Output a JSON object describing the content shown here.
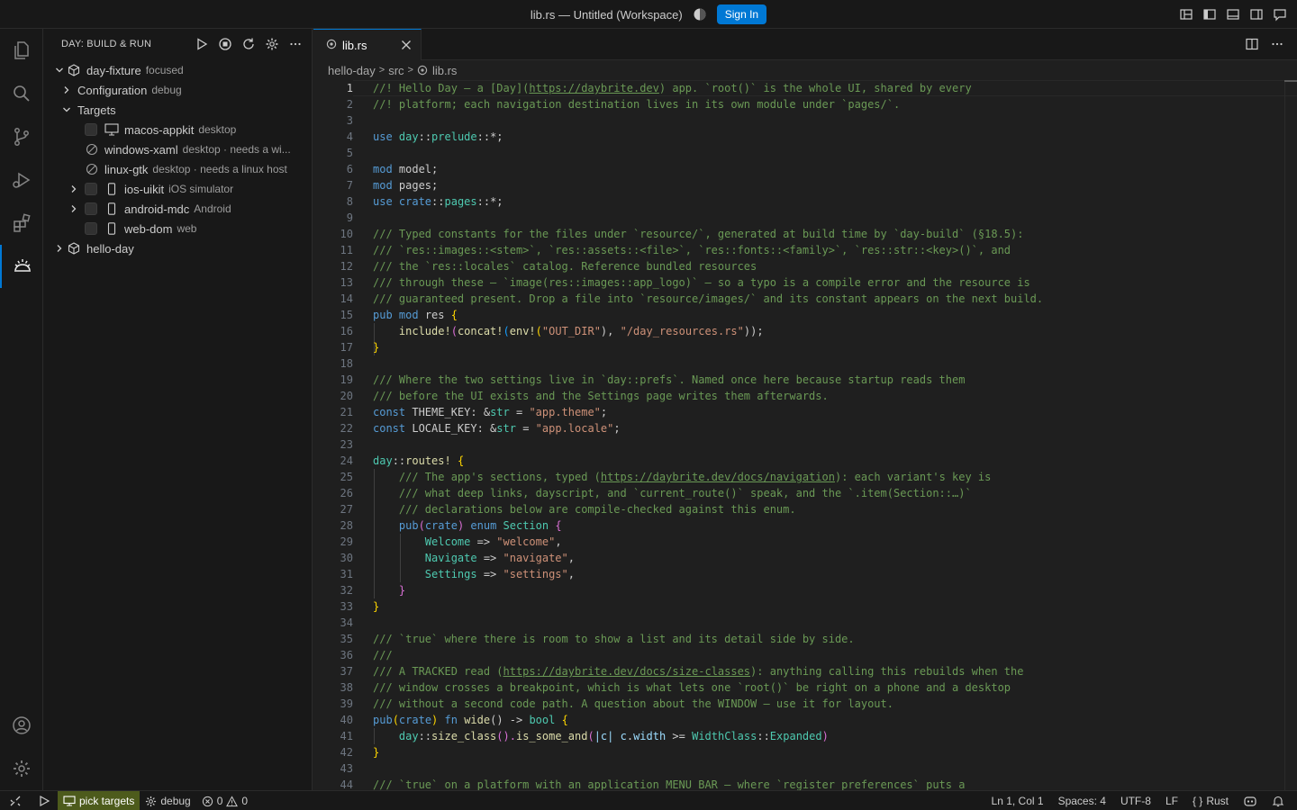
{
  "window": {
    "title": "lib.rs — Untitled (Workspace)",
    "sign_in_label": "Sign In"
  },
  "sidebar": {
    "title": "DAY: BUILD & RUN",
    "tree": [
      {
        "label": "day-fixture",
        "desc": "focused"
      },
      {
        "label": "Configuration",
        "desc": "debug"
      },
      {
        "label": "Targets",
        "desc": ""
      },
      {
        "label": "macos-appkit",
        "desc": "desktop"
      },
      {
        "label": "windows-xaml",
        "desc": "desktop · needs a wi..."
      },
      {
        "label": "linux-gtk",
        "desc": "desktop · needs a linux host"
      },
      {
        "label": "ios-uikit",
        "desc": "iOS simulator"
      },
      {
        "label": "android-mdc",
        "desc": "Android"
      },
      {
        "label": "web-dom",
        "desc": "web"
      },
      {
        "label": "hello-day",
        "desc": ""
      }
    ]
  },
  "editor": {
    "tab_label": "lib.rs",
    "breadcrumb": [
      "hello-day",
      "src",
      "lib.rs"
    ],
    "line_numbers": [
      "1",
      "2",
      "3",
      "4",
      "5",
      "6",
      "7",
      "8",
      "9",
      "10",
      "11",
      "12",
      "13",
      "14",
      "15",
      "16",
      "17",
      "18",
      "19",
      "20",
      "21",
      "22",
      "23",
      "24",
      "25",
      "26",
      "27",
      "28",
      "29",
      "30",
      "31",
      "32",
      "33",
      "34",
      "35",
      "36",
      "37",
      "38",
      "39",
      "40",
      "41",
      "42",
      "43",
      "44"
    ],
    "lines": {
      "l1": [
        "//! Hello Day — a [Day](",
        "https://daybrite.dev",
        ") app. `root()` is the whole UI, shared by every"
      ],
      "l2": "//! platform; each navigation destination lives in its own module under `pages/`.",
      "l4": [
        "use",
        " day",
        "::",
        "prelude",
        "::*;"
      ],
      "l6": [
        "mod",
        " model;"
      ],
      "l7": [
        "mod",
        " pages;"
      ],
      "l8": [
        "use",
        " crate",
        "::",
        "pages",
        "::*;"
      ],
      "l10": "/// Typed constants for the files under `resource/`, generated at build time by `day-build` (§18.5):",
      "l11": "/// `res::images::<stem>`, `res::assets::<file>`, `res::fonts::<family>`, `res::str::<key>()`, and",
      "l12": "/// the `res::locales` catalog. Reference bundled resources",
      "l13": "/// through these — `image(res::images::app_logo)` — so a typo is a compile error and the resource is",
      "l14": "/// guaranteed present. Drop a file into `resource/images/` and its constant appears on the next build.",
      "l15": [
        "pub",
        " mod",
        " res ",
        "{"
      ],
      "l16": [
        "    include!",
        "(",
        "concat!",
        "(",
        "env!",
        "(",
        "\"OUT_DIR\"",
        "), ",
        "\"/day_resources.rs\"",
        "));"
      ],
      "l17": "}",
      "l19": "/// Where the two settings live in `day::prefs`. Named once here because startup reads them",
      "l20": "/// before the UI exists and the Settings page writes them afterwards.",
      "l21": [
        "const",
        " THEME_KEY",
        ": &",
        "str",
        " = ",
        "\"app.theme\"",
        ";"
      ],
      "l22": [
        "const",
        " LOCALE_KEY",
        ": &",
        "str",
        " = ",
        "\"app.locale\"",
        ";"
      ],
      "l24": [
        "day",
        "::",
        "routes!",
        " {"
      ],
      "l25": [
        "    /// The app's sections, typed (",
        "https://daybrite.dev/docs/navigation",
        "): each variant's key is"
      ],
      "l26": "    /// what deep links, dayscript, and `current_route()` speak, and the `.item(Section::…)`",
      "l27": "    /// declarations below are compile-checked against this enum.",
      "l28": [
        "    pub",
        "(",
        "crate",
        ")",
        " enum",
        " Section",
        " {"
      ],
      "l29": [
        "        Welcome",
        " => ",
        "\"welcome\"",
        ","
      ],
      "l30": [
        "        Navigate",
        " => ",
        "\"navigate\"",
        ","
      ],
      "l31": [
        "        Settings",
        " => ",
        "\"settings\"",
        ","
      ],
      "l32": "    }",
      "l33": "}",
      "l35": "/// `true` where there is room to show a list and its detail side by side.",
      "l36": "///",
      "l37": [
        "/// A TRACKED read (",
        "https://daybrite.dev/docs/size-classes",
        "): anything calling this rebuilds when the"
      ],
      "l38": "/// window crosses a breakpoint, which is what lets one `root()` be right on a phone and a desktop",
      "l39": "/// without a second code path. A question about the WINDOW — use it for layout.",
      "l40": [
        "pub",
        "(",
        "crate",
        ")",
        " fn",
        " wide",
        "() -> ",
        "bool",
        " {"
      ],
      "l41": [
        "    day",
        "::",
        "size_class",
        "().",
        "is_some_and",
        "(",
        "|c| ",
        "c",
        ".",
        "width",
        " >= ",
        "WidthClass",
        "::",
        "Expanded",
        ")"
      ],
      "l42": "}",
      "l44": "/// `true` on a platform with an application MENU BAR — where `register_preferences` puts a"
    }
  },
  "status": {
    "targets_label": "pick targets",
    "config_label": "debug",
    "errors": "0",
    "warnings": "0",
    "cursor": "Ln 1, Col 1",
    "spaces": "Spaces: 4",
    "encoding": "UTF-8",
    "eol": "LF",
    "language": "Rust"
  },
  "colors": {
    "accent": "#0078d4",
    "status_accent": "#4d5b1c"
  }
}
